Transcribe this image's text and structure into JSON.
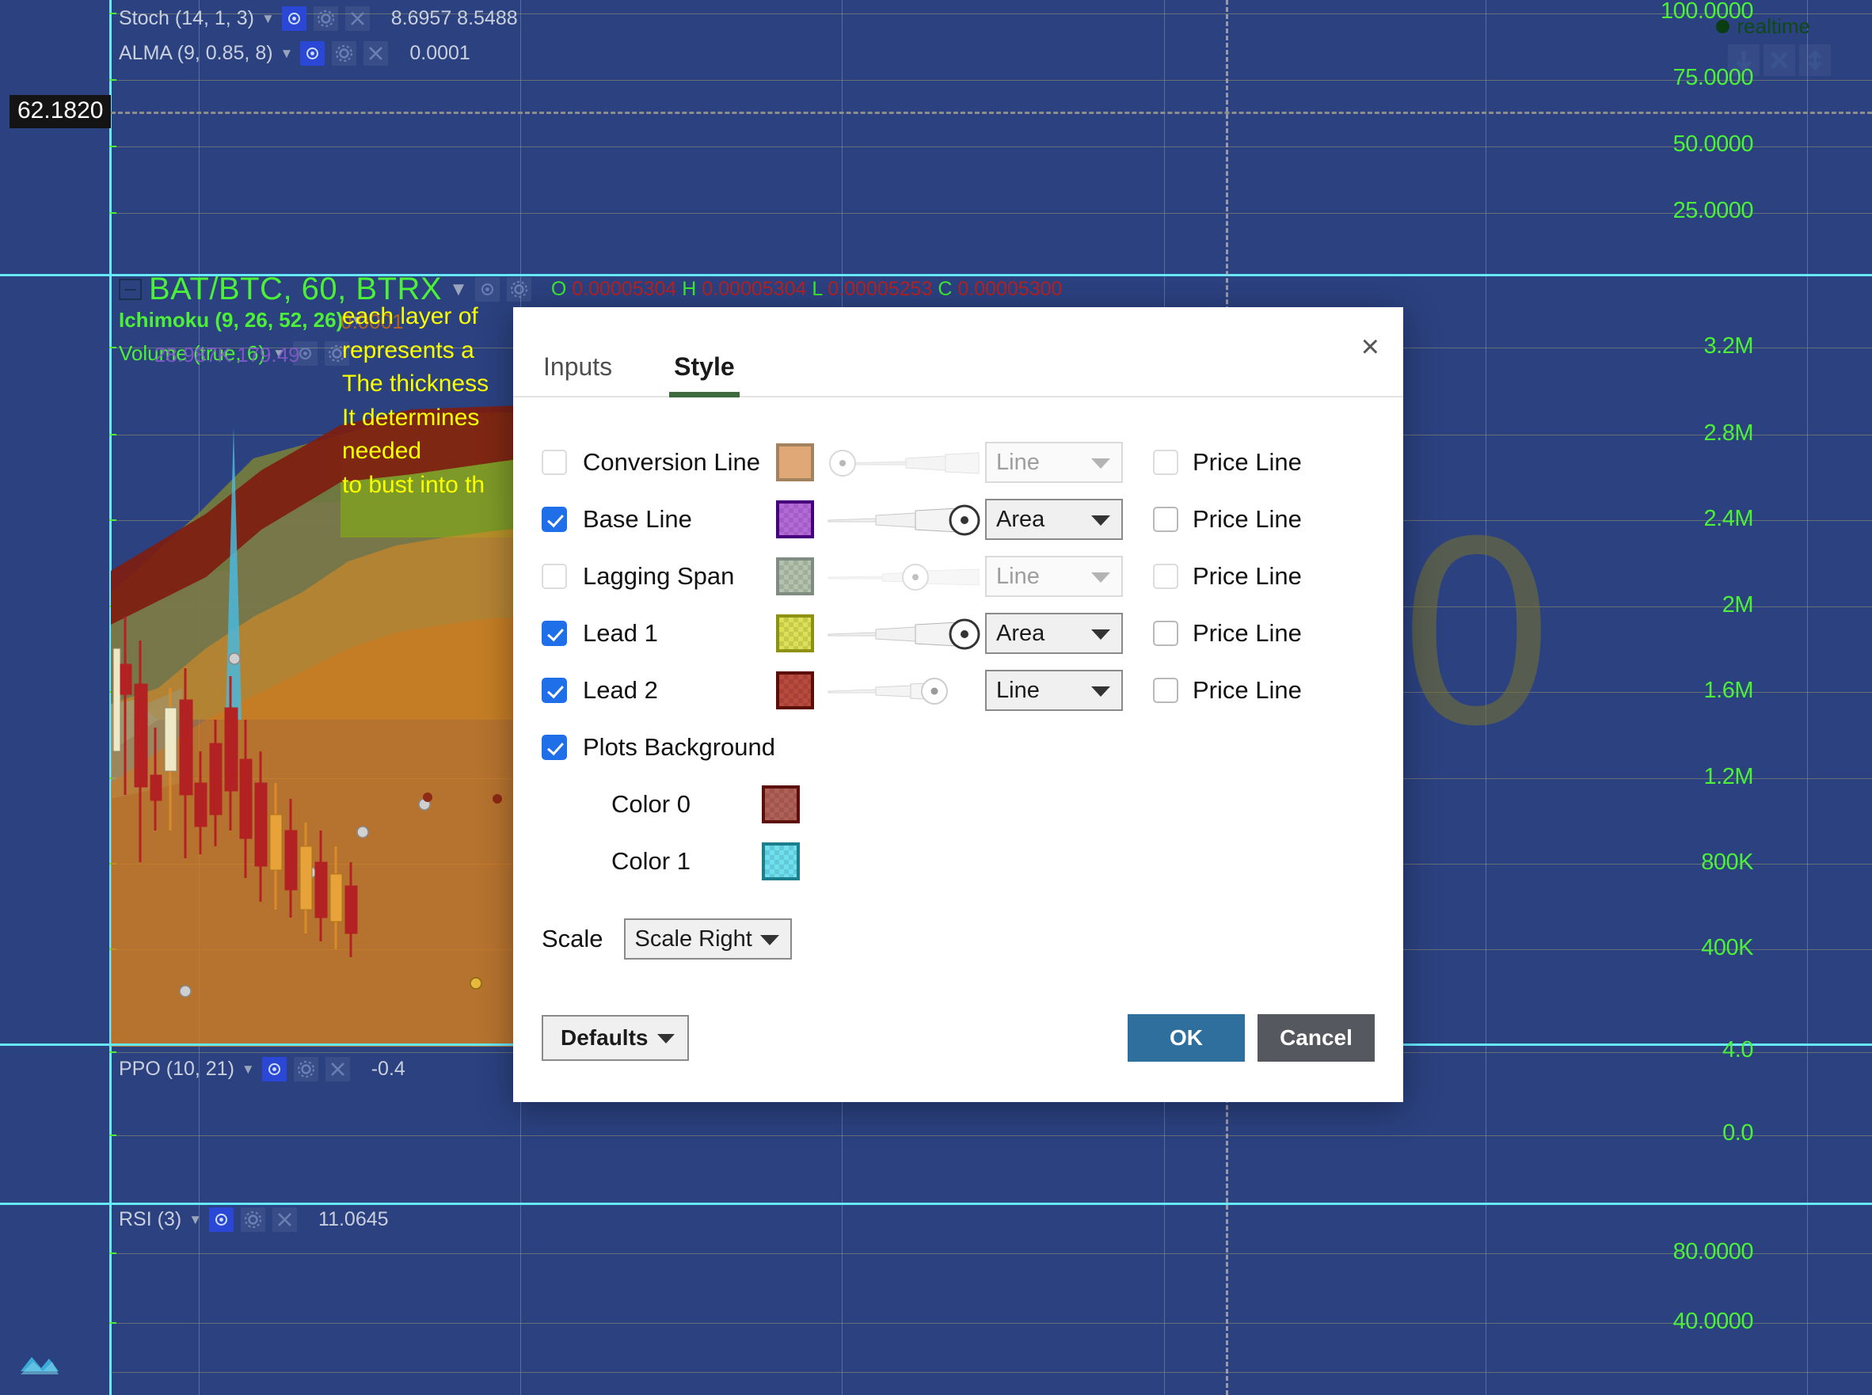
{
  "chart": {
    "top_pane": {
      "axis_labels": [
        "100.0000",
        "75.0000",
        "50.0000",
        "25.0000"
      ],
      "price_badge": "62.1820",
      "indicators": [
        {
          "name": "Stoch (14, 1, 3)",
          "values": "8.6957 8.5488"
        },
        {
          "name": "ALMA (9, 0.85, 8)",
          "values": "0.0001"
        }
      ]
    },
    "main_pane": {
      "symbol": "BAT/BTC, 60, BTRX",
      "ohlc": [
        {
          "key": "O",
          "value": "0.00005304"
        },
        {
          "key": "H",
          "value": "0.00005304"
        },
        {
          "key": "L",
          "value": "0.00005253"
        },
        {
          "key": "C",
          "value": "0.00005300"
        }
      ],
      "indicators": [
        {
          "name": "Ichimoku (9, 26, 52, 26)",
          "values": "0.0001"
        },
        {
          "name": "Volume (true, 6)",
          "values": "28.987K  179.49"
        }
      ],
      "axis_labels": [
        "3.2M",
        "2.8M",
        "2.4M",
        "2M",
        "1.6M",
        "1.2M",
        "800K",
        "400K"
      ]
    },
    "ppo_pane": {
      "indicator": "PPO (10, 21)",
      "value": "-0.4",
      "axis_labels": [
        "4.0",
        "0.0"
      ]
    },
    "rsi_pane": {
      "indicator": "RSI (3)",
      "value": "11.0645",
      "axis_labels": [
        "80.0000",
        "40.0000"
      ]
    },
    "annotation": "each layer of\nrepresents a\nThe thickness\nIt determines\nneeded\nto bust into th",
    "realtime_label": "realtime",
    "icons": {
      "eye": "eye-icon",
      "gear": "gear-icon",
      "close": "x-icon",
      "caret": "chevron-down-icon",
      "collapse": "collapse-icon",
      "scroll_left": "arrow-down-icon",
      "scroll_reset": "x-icon",
      "scale_reset": "arrows-vertical-icon"
    }
  },
  "dialog": {
    "close_glyph": "×",
    "tabs": [
      {
        "id": "inputs",
        "label": "Inputs",
        "active": false
      },
      {
        "id": "style",
        "label": "Style",
        "active": true
      }
    ],
    "style_rows": [
      {
        "label": "Conversion Line",
        "checked": false,
        "color": "#e0a777",
        "border": "#a3825f",
        "checkered": false,
        "slider_pos": 0.03,
        "slider_enabled": false,
        "plot_type": "Line",
        "plot_enabled": false,
        "price_line_label": "Price Line",
        "price_line_checked": false
      },
      {
        "label": "Base Line",
        "checked": true,
        "color": "#b469d8",
        "border": "#46007d",
        "checkered": true,
        "slider_pos": 0.94,
        "slider_enabled": true,
        "plot_type": "Area",
        "plot_enabled": true,
        "price_line_label": "Price Line",
        "price_line_checked": false
      },
      {
        "label": "Lagging Span",
        "checked": false,
        "color": "#b2c2ad",
        "border": "#7e8c84",
        "checkered": true,
        "slider_pos": 0.62,
        "slider_enabled": false,
        "plot_type": "Line",
        "plot_enabled": false,
        "price_line_label": "Price Line",
        "price_line_checked": false
      },
      {
        "label": "Lead 1",
        "checked": true,
        "color": "#dbe055",
        "border": "#8d9213",
        "checkered": true,
        "slider_pos": 0.94,
        "slider_enabled": true,
        "plot_type": "Area",
        "plot_enabled": true,
        "price_line_label": "Price Line",
        "price_line_checked": false
      },
      {
        "label": "Lead 2",
        "checked": true,
        "color": "#b94a3e",
        "border": "#5c0e06",
        "checkered": true,
        "slider_pos": 0.66,
        "slider_enabled": true,
        "plot_type": "Line",
        "plot_enabled": true,
        "price_line_label": "Price Line",
        "price_line_checked": false
      }
    ],
    "plots_background": {
      "label": "Plots Background",
      "checked": true,
      "colors": [
        {
          "label": "Color 0",
          "color": "#b06057",
          "border": "#5b100a",
          "checkered": true
        },
        {
          "label": "Color 1",
          "color": "#6ee0ef",
          "border": "#1d7f8b",
          "checkered": true
        }
      ]
    },
    "scale": {
      "label": "Scale",
      "value": "Scale Right"
    },
    "footer": {
      "defaults_label": "Defaults",
      "ok_label": "OK",
      "cancel_label": "Cancel"
    }
  }
}
